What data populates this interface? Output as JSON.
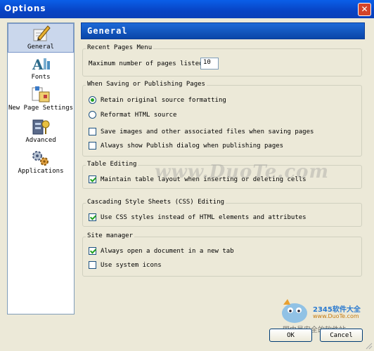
{
  "window": {
    "title": "Options",
    "close_glyph": "✕"
  },
  "sidebar": {
    "items": [
      {
        "label": "General",
        "icon": "pen-paper-icon",
        "selected": true
      },
      {
        "label": "Fonts",
        "icon": "fonts-icon",
        "selected": false
      },
      {
        "label": "New Page Settings",
        "icon": "page-settings-icon",
        "selected": false
      },
      {
        "label": "Advanced",
        "icon": "advanced-icon",
        "selected": false
      },
      {
        "label": "Applications",
        "icon": "gears-icon",
        "selected": false
      }
    ]
  },
  "panel": {
    "header": "General"
  },
  "recent_pages": {
    "legend": "Recent Pages Menu",
    "max_label": "Maximum number of pages listed:",
    "max_value": "10"
  },
  "saving": {
    "legend": "When Saving or Publishing Pages",
    "retain_label": "Retain original source formatting",
    "retain_checked": true,
    "reformat_label": "Reformat HTML source",
    "reformat_checked": false,
    "save_images_label": "Save images and other associated files when saving pages",
    "save_images_checked": false,
    "publish_dialog_label": "Always show Publish dialog when publishing pages",
    "publish_dialog_checked": false
  },
  "table_editing": {
    "legend": "Table Editing",
    "maintain_label": "Maintain table layout when inserting or deleting cells",
    "maintain_checked": true
  },
  "css_editing": {
    "legend": "Cascading Style Sheets (CSS) Editing",
    "use_css_label": "Use CSS styles instead of HTML elements and attributes",
    "use_css_checked": true
  },
  "site_manager": {
    "legend": "Site manager",
    "new_tab_label": "Always open a document in a new tab",
    "new_tab_checked": true,
    "system_icons_label": "Use system icons",
    "system_icons_checked": false
  },
  "buttons": {
    "ok": "OK",
    "cancel": "Cancel"
  },
  "watermarks": {
    "center": "www.DuoTe.com",
    "brand": "2345软件大全",
    "brand_url": "www.DuoTe.com",
    "footer": "国内最安全的软件站"
  },
  "colors": {
    "accent": "#0a46a8",
    "title_bar": "#0843c4",
    "check": "#21a121"
  }
}
